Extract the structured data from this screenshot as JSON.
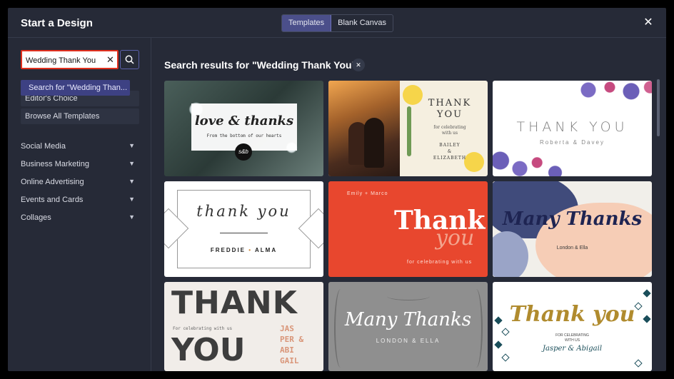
{
  "header": {
    "title": "Start a Design",
    "tabs": [
      {
        "label": "Templates",
        "active": true
      },
      {
        "label": "Blank Canvas",
        "active": false
      }
    ],
    "close_icon": "close-icon"
  },
  "sidebar": {
    "search_value": "Wedding Thank You",
    "suggestion": "Search for \"Wedding Than...",
    "items": [
      {
        "label": "Editor's Choice"
      },
      {
        "label": "Browse All Templates"
      }
    ],
    "categories": [
      {
        "label": "Social Media"
      },
      {
        "label": "Business Marketing"
      },
      {
        "label": "Online Advertising"
      },
      {
        "label": "Events and Cards"
      },
      {
        "label": "Collages"
      }
    ]
  },
  "main": {
    "results_title": "Search results for \"Wedding Thank You\"",
    "cards": [
      {
        "lines": [
          "love & thanks",
          "From the bottom of our hearts",
          "s&b"
        ]
      },
      {
        "lines": [
          "THANK",
          "YOU",
          "for celebrating",
          "with us",
          "BAILEY",
          "&",
          "ELIZABETH"
        ]
      },
      {
        "lines": [
          "THANK YOU",
          "Roberta & Davey"
        ]
      },
      {
        "lines": [
          "thank you",
          "FREDDIE",
          "•",
          "ALMA"
        ]
      },
      {
        "lines": [
          "Emily + Marco",
          "Thank",
          "you",
          "for celebrating with us"
        ]
      },
      {
        "lines": [
          "Many Thanks",
          "London & Ella"
        ]
      },
      {
        "lines": [
          "THANK",
          "For celebrating with us",
          "YOU",
          "JAS",
          "PER &",
          "ABI",
          "GAIL"
        ]
      },
      {
        "lines": [
          "Many Thanks",
          "LONDON & ELLA"
        ]
      },
      {
        "lines": [
          "Thank you",
          "FOR CELEBRATING",
          "WITH US",
          "Jasper & Abigail"
        ]
      }
    ]
  },
  "colors": {
    "modal_bg": "#262a37",
    "accent": "#4b4f8a",
    "highlight_border": "#e0301e"
  }
}
